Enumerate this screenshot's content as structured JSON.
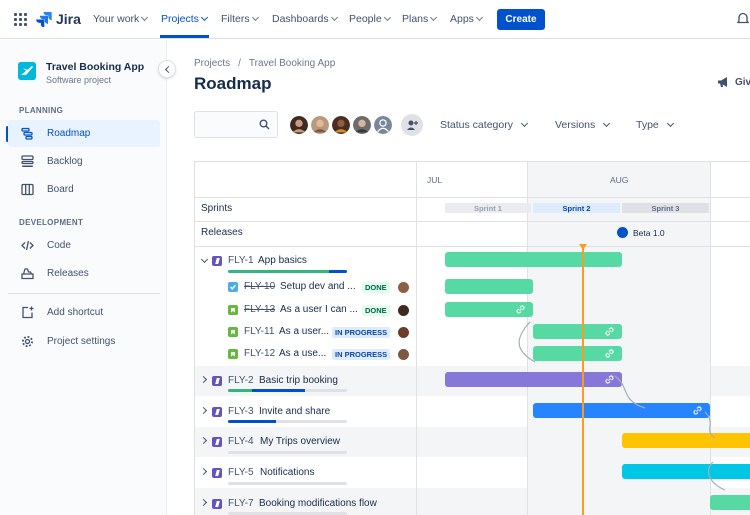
{
  "nav": {
    "logo": "Jira",
    "items": [
      {
        "label": "Your work"
      },
      {
        "label": "Projects"
      },
      {
        "label": "Filters"
      },
      {
        "label": "Dashboards"
      },
      {
        "label": "People"
      },
      {
        "label": "Plans"
      },
      {
        "label": "Apps"
      }
    ],
    "active_item": "Projects",
    "create_label": "Create"
  },
  "sidebar": {
    "project_name": "Travel Booking App",
    "project_type": "Software project",
    "planning_header": "PLANNING",
    "planning_items": [
      {
        "label": "Roadmap",
        "icon": "roadmap-icon",
        "active": true
      },
      {
        "label": "Backlog",
        "icon": "backlog-icon"
      },
      {
        "label": "Board",
        "icon": "board-icon"
      }
    ],
    "development_header": "DEVELOPMENT",
    "development_items": [
      {
        "label": "Code",
        "icon": "code-icon"
      },
      {
        "label": "Releases",
        "icon": "releases-icon"
      }
    ],
    "add_shortcut": "Add shortcut",
    "project_settings": "Project settings"
  },
  "main": {
    "breadcrumb": [
      "Projects",
      "/",
      "Travel Booking App"
    ],
    "title": "Roadmap",
    "give_feedback": "Giv",
    "search_placeholder": "",
    "filters": [
      {
        "label": "Status category"
      },
      {
        "label": "Versions"
      },
      {
        "label": "Type"
      }
    ]
  },
  "roadmap": {
    "months": [
      "JUL",
      "AUG"
    ],
    "sprints_label": "Sprints",
    "sprints": [
      "Sprint 1",
      "Sprint 2",
      "Sprint 3"
    ],
    "releases_label": "Releases",
    "release": "Beta 1.0",
    "epics": [
      {
        "key": "FLY-1",
        "title": "App basics",
        "expanded": true,
        "progress_done": 0.85,
        "progress_inprogress": 0.15,
        "color": "#57D9A3",
        "children": [
          {
            "key": "FLY-10",
            "title": "Setup dev and ...",
            "type": "task",
            "status": "DONE",
            "done": true
          },
          {
            "key": "FLY-13",
            "title": "As a user I can ...",
            "type": "story",
            "status": "DONE",
            "done": true
          },
          {
            "key": "FLY-11",
            "title": "As a user...",
            "type": "story",
            "status": "IN PROGRESS",
            "done": false
          },
          {
            "key": "FLY-12",
            "title": "As a use...",
            "type": "story",
            "status": "IN PROGRESS",
            "done": false
          }
        ]
      },
      {
        "key": "FLY-2",
        "title": "Basic trip booking",
        "progress_done": 0.2,
        "progress_inprogress": 0.45,
        "color": "#8777D9"
      },
      {
        "key": "FLY-3",
        "title": "Invite and share",
        "progress_done": 0,
        "progress_inprogress": 0.4,
        "color": "#2684FF"
      },
      {
        "key": "FLY-4",
        "title": "My Trips overview",
        "progress_done": 0,
        "progress_inprogress": 0,
        "color": "#FFC400"
      },
      {
        "key": "FLY-5",
        "title": "Notifications",
        "progress_done": 0,
        "progress_inprogress": 0,
        "color": "#00C7E6"
      },
      {
        "key": "FLY-7",
        "title": "Booking modifications flow",
        "progress_done": 0,
        "progress_inprogress": 0,
        "color": "#57D9A3"
      }
    ]
  }
}
